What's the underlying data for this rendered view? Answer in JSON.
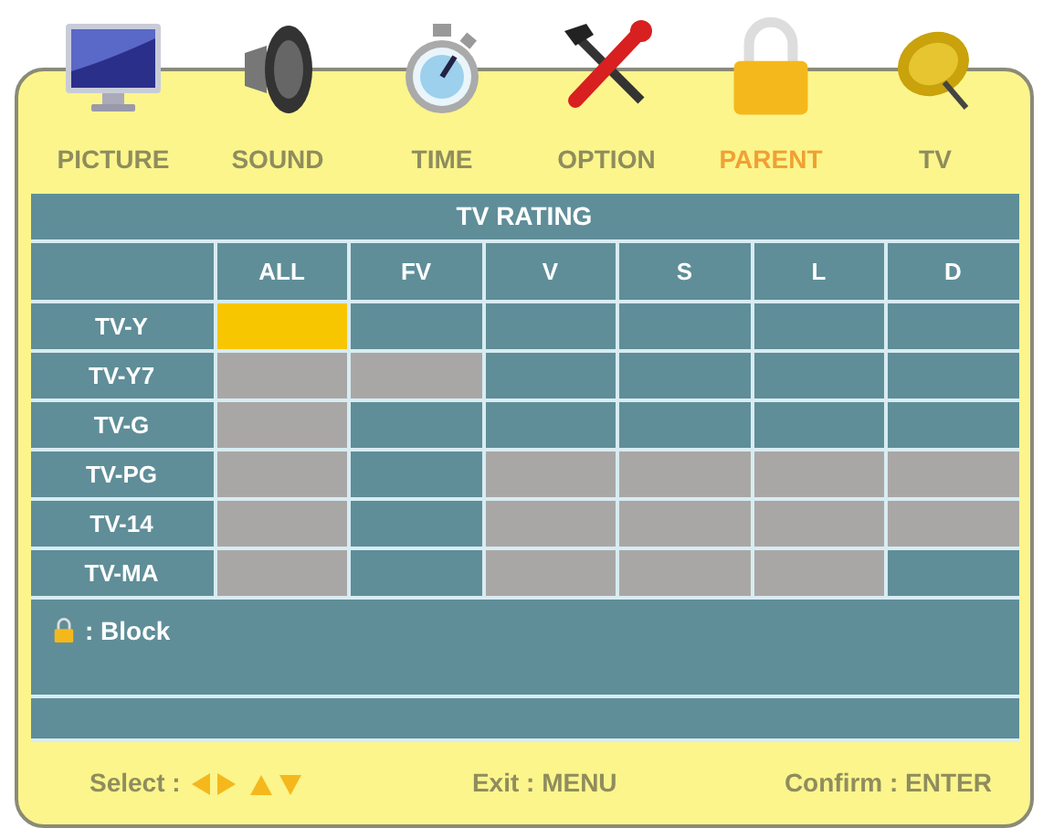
{
  "menu": {
    "tabs": [
      {
        "label": "PICTURE",
        "selected": false
      },
      {
        "label": "SOUND",
        "selected": false
      },
      {
        "label": "TIME",
        "selected": false
      },
      {
        "label": "OPTION",
        "selected": false
      },
      {
        "label": "PARENT",
        "selected": true
      },
      {
        "label": "TV",
        "selected": false
      }
    ]
  },
  "table": {
    "title": "TV RATING",
    "columns": [
      "ALL",
      "FV",
      "V",
      "S",
      "L",
      "D"
    ],
    "rows": [
      {
        "label": "TV-Y",
        "cells": [
          {
            "selected": true
          },
          {
            "blocked": false,
            "selected": false
          },
          {
            "blocked": false,
            "selected": false
          },
          {
            "blocked": false,
            "selected": false
          },
          {
            "blocked": false,
            "selected": false
          },
          {
            "blocked": false,
            "selected": false
          }
        ]
      },
      {
        "label": "TV-Y7",
        "cells": [
          {
            "blocked": true,
            "selected": false
          },
          {
            "blocked": true,
            "selected": false
          },
          {
            "blocked": false,
            "selected": false
          },
          {
            "blocked": false,
            "selected": false
          },
          {
            "blocked": false,
            "selected": false
          },
          {
            "blocked": false,
            "selected": false
          }
        ]
      },
      {
        "label": "TV-G",
        "cells": [
          {
            "blocked": true,
            "selected": false
          },
          {
            "blocked": false,
            "selected": false
          },
          {
            "blocked": false,
            "selected": false
          },
          {
            "blocked": false,
            "selected": false
          },
          {
            "blocked": false,
            "selected": false
          },
          {
            "blocked": false,
            "selected": false
          }
        ]
      },
      {
        "label": "TV-PG",
        "cells": [
          {
            "blocked": true,
            "selected": false
          },
          {
            "blocked": false,
            "selected": false
          },
          {
            "blocked": true,
            "selected": false
          },
          {
            "blocked": true,
            "selected": false
          },
          {
            "blocked": true,
            "selected": false
          },
          {
            "blocked": true,
            "selected": false
          }
        ]
      },
      {
        "label": "TV-14",
        "cells": [
          {
            "blocked": true,
            "selected": false
          },
          {
            "blocked": false,
            "selected": false
          },
          {
            "blocked": true,
            "selected": false
          },
          {
            "blocked": true,
            "selected": false
          },
          {
            "blocked": true,
            "selected": false
          },
          {
            "blocked": true,
            "selected": false
          }
        ]
      },
      {
        "label": "TV-MA",
        "cells": [
          {
            "blocked": true,
            "selected": false
          },
          {
            "blocked": false,
            "selected": false
          },
          {
            "blocked": true,
            "selected": false
          },
          {
            "blocked": true,
            "selected": false
          },
          {
            "blocked": true,
            "selected": false
          },
          {
            "blocked": false,
            "selected": false
          }
        ]
      }
    ]
  },
  "legend": {
    "text": ": Block"
  },
  "footer": {
    "select": "Select :",
    "exit": "Exit : MENU",
    "confirm": "Confirm : ENTER"
  }
}
